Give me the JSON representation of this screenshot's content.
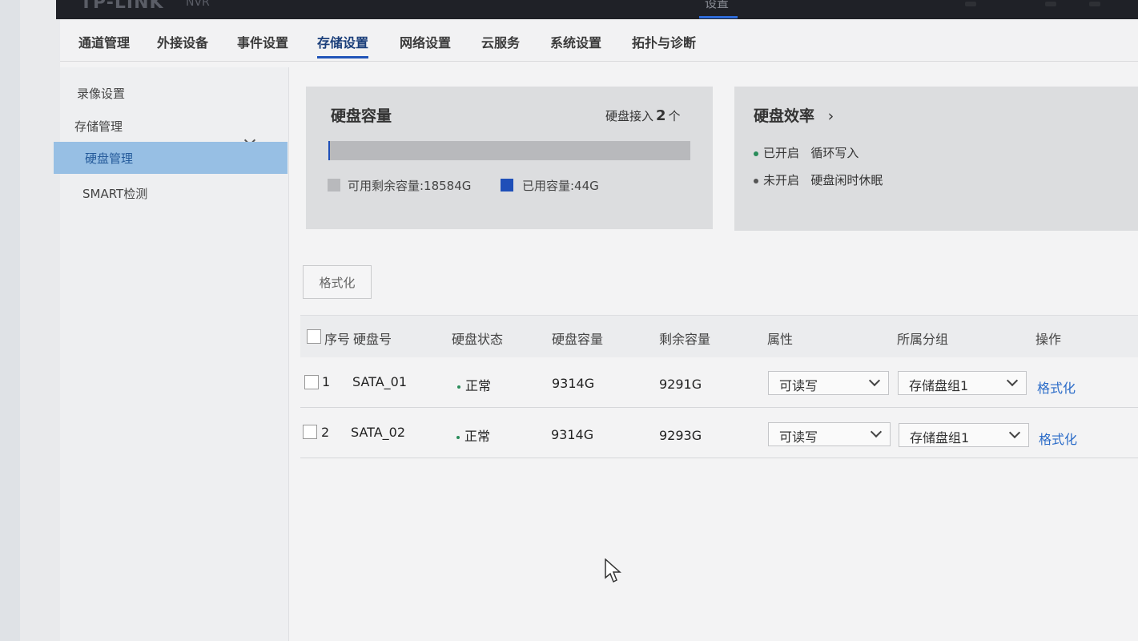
{
  "header": {
    "logo": "TP-LINK",
    "product": "NVR",
    "title": "设置"
  },
  "tabs": [
    {
      "label": "通道管理"
    },
    {
      "label": "外接设备"
    },
    {
      "label": "事件设置"
    },
    {
      "label": "存储设置"
    },
    {
      "label": "网络设置"
    },
    {
      "label": "云服务"
    },
    {
      "label": "系统设置"
    },
    {
      "label": "拓扑与诊断"
    }
  ],
  "sidebar": {
    "items": [
      {
        "label": "录像设置"
      },
      {
        "label": "存储管理"
      },
      {
        "label": "硬盘管理"
      },
      {
        "label": "SMART检测"
      }
    ]
  },
  "capacity": {
    "title": "硬盘容量",
    "disks_label": "硬盘接入",
    "disks_count": "2",
    "disks_unit": "个",
    "free_label": "可用剩余容量:18584G",
    "used_label": "已用容量:44G",
    "free_gb": 18584,
    "used_gb": 44,
    "free_color": "#b8b9bc",
    "used_color": "#1f4fb8"
  },
  "efficiency": {
    "title": "硬盘效率",
    "items": [
      {
        "state": "已开启",
        "feature": "循环写入"
      },
      {
        "state": "未开启",
        "feature": "硬盘闲时休眠"
      }
    ]
  },
  "toolbar": {
    "format_label": "格式化"
  },
  "table": {
    "headers": [
      "序号",
      "硬盘号",
      "硬盘状态",
      "硬盘容量",
      "剩余容量",
      "属性",
      "所属分组",
      "操作"
    ],
    "rows": [
      {
        "index": "1",
        "disk": "SATA_01",
        "status": "正常",
        "capacity": "9314G",
        "remaining": "9291G",
        "attribute": "可读写",
        "group": "存储盘组1",
        "action": "格式化"
      },
      {
        "index": "2",
        "disk": "SATA_02",
        "status": "正常",
        "capacity": "9314G",
        "remaining": "9293G",
        "attribute": "可读写",
        "group": "存储盘组1",
        "action": "格式化"
      }
    ]
  }
}
